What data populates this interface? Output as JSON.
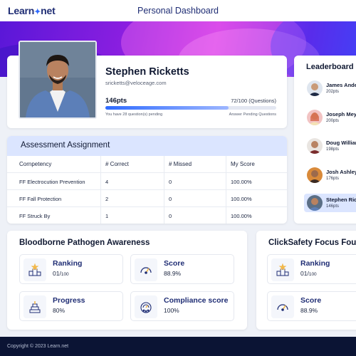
{
  "header": {
    "logo_left": "Learn",
    "logo_right": "net",
    "title": "Personal Dashboard"
  },
  "profile": {
    "name": "Stephen Ricketts",
    "email": "sricketts@veloceage.com",
    "points": "146pts",
    "questions": "72/100 (Questions)",
    "progress_fraction": 0.72,
    "pending_text": "You have 28 question(s) pending",
    "answer_pending": "Answer Pending Questions"
  },
  "leaderboard": {
    "title": "Leaderboard",
    "items": [
      {
        "name": "James Anderson",
        "points": "202pts",
        "active": false
      },
      {
        "name": "Joseph Meyers",
        "points": "200pts",
        "active": false
      },
      {
        "name": "Doug Williams",
        "points": "198pts",
        "active": false
      },
      {
        "name": "Josh Ashley",
        "points": "176pts",
        "active": false
      },
      {
        "name": "Stephen Ricketts",
        "points": "146pts",
        "active": true
      }
    ]
  },
  "assessment": {
    "title": "Assessment Assignment",
    "columns": [
      "Cornpetency",
      "# Correct",
      "# Missed",
      "My Score"
    ],
    "rows": [
      [
        "FF Electrocution Prevention",
        "4",
        "0",
        "100.00%"
      ],
      [
        "FF Fall Protection",
        "2",
        "0",
        "100.00%"
      ],
      [
        "FF Struck By",
        "1",
        "0",
        "100.00%"
      ]
    ]
  },
  "courses": [
    {
      "title": "Bloodborne Pathogen Awareness",
      "ranking_label": "Ranking",
      "ranking_value": "01/",
      "ranking_total": "100",
      "score_label": "Score",
      "score_value": "88.9%",
      "progress_label": "Progress",
      "progress_value": "80%",
      "compliance_label": "Compliance score",
      "compliance_value": "100%"
    },
    {
      "title": "ClickSafety Focus Four",
      "ranking_label": "Ranking",
      "ranking_value": "01/",
      "ranking_total": "100",
      "score_label": "Score",
      "score_value": "88.9%"
    }
  ],
  "footer": {
    "copyright": "Copyright © 2023 Learn.net"
  },
  "colors": {
    "brand": "#1f2d74",
    "accent": "#2f6bff",
    "highlight": "#dbe5ff",
    "footer": "#0b1434"
  }
}
